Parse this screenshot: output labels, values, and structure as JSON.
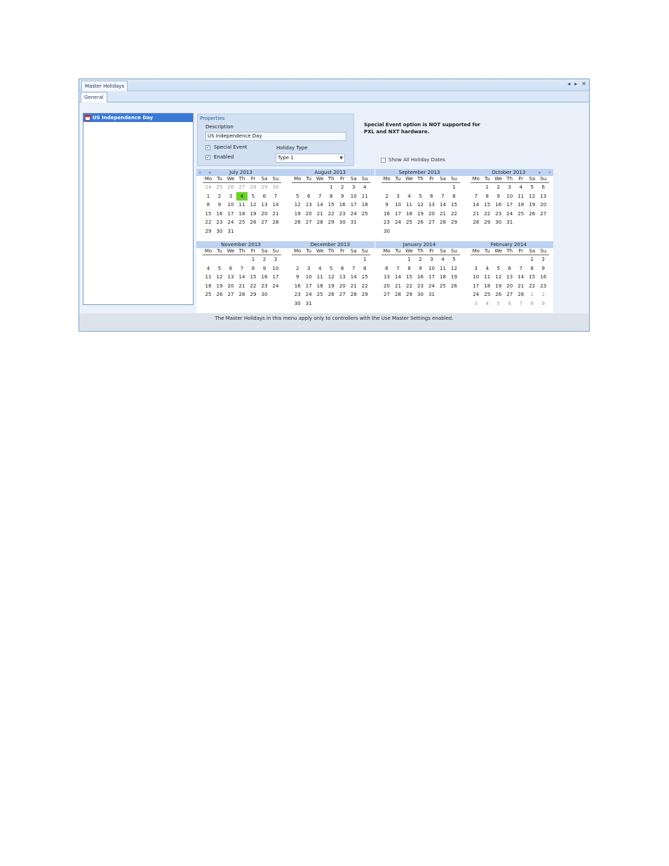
{
  "window": {
    "title": "Master Holidays",
    "controls": [
      "◂",
      "▸",
      "✕"
    ],
    "subtab": "General"
  },
  "holidays": {
    "items": [
      {
        "label": "US Independence Day"
      }
    ]
  },
  "properties": {
    "title": "Properties",
    "description_label": "Description",
    "description_value": "US Independence Day",
    "special_event_label": "Special Event",
    "special_event_checked": true,
    "enabled_label": "Enabled",
    "enabled_checked": true,
    "holiday_type_label": "Holiday Type",
    "holiday_type_value": "Type 1"
  },
  "notice": {
    "line1": "Special Event option is NOT supported for",
    "line2": "PXL and NXT hardware."
  },
  "show_all": {
    "label": "Show All Holiday Dates",
    "checked": false
  },
  "calendar": {
    "dow": [
      "Mo",
      "Tu",
      "We",
      "Th",
      "Fr",
      "Sa",
      "Su"
    ],
    "highlight_color": "#6ed12a",
    "months": [
      {
        "title": "July 2013",
        "offset": 0,
        "days": 31,
        "lead": [
          24,
          25,
          26,
          27,
          28,
          29,
          30
        ],
        "trail": [],
        "highlight": 4
      },
      {
        "title": "August 2013",
        "offset": 3,
        "days": 31,
        "lead": [],
        "trail": [],
        "highlight": 0
      },
      {
        "title": "September 2013",
        "offset": 6,
        "days": 30,
        "lead": [],
        "trail": [],
        "highlight": 0
      },
      {
        "title": "October 2013",
        "offset": 1,
        "days": 31,
        "lead": [],
        "trail": [],
        "highlight": 0
      },
      {
        "title": "November 2013",
        "offset": 4,
        "days": 30,
        "lead": [],
        "trail": [],
        "highlight": 0
      },
      {
        "title": "December 2013",
        "offset": 6,
        "days": 31,
        "lead": [],
        "trail": [],
        "highlight": 0
      },
      {
        "title": "January 2014",
        "offset": 2,
        "days": 31,
        "lead": [],
        "trail": [],
        "highlight": 0
      },
      {
        "title": "February 2014",
        "offset": 5,
        "days": 28,
        "lead": [],
        "trail": [
          1,
          2,
          3,
          4,
          5,
          6,
          7,
          8,
          9
        ],
        "highlight": 0
      }
    ]
  },
  "footer": {
    "text": "The Master Holidays in this menu apply only to controllers with the Use Master Settings enabled."
  }
}
